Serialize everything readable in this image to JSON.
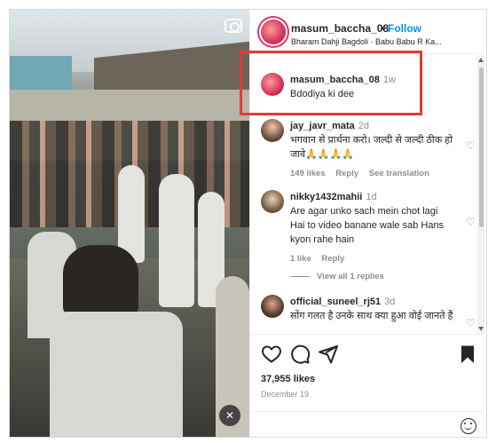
{
  "post": {
    "author": "masum_baccha_08",
    "follow_label": "Follow",
    "dot": "•",
    "audio": "Bharam Dahji Bagdoli · Babu Babu R Ka..."
  },
  "comments": [
    {
      "user": "masum_baccha_08",
      "time": "1w",
      "text": "Bdodiya ki dee"
    },
    {
      "user": "jay_javr_mata",
      "time": "2d",
      "text": "भगवान से प्रार्थना करो। जल्दी से जल्दी ठीक हो जावे🙏🙏🙏🙏",
      "likes": "149 likes",
      "reply": "Reply",
      "translate": "See translation"
    },
    {
      "user": "nikky1432mahii",
      "time": "1d",
      "text": "Are agar unko sach mein chot lagi Hai to video banane wale sab Hans kyon rahe hain",
      "likes": "1 like",
      "reply": "Reply",
      "view_replies": "View all 1 replies"
    },
    {
      "user": "official_suneel_rj51",
      "time": "3d",
      "text": "सोंग गलत है उनके साथ क्या हुआ वोई जानते हैं"
    }
  ],
  "footer": {
    "likes": "37,955 likes",
    "date": "December 19"
  },
  "icons": {
    "like": "heart-icon",
    "comment": "comment-icon",
    "share": "share-icon",
    "save": "bookmark-icon",
    "emoji": "emoji-icon",
    "camera": "camera-icon",
    "mute": "mute-icon"
  },
  "colors": {
    "link": "#0095f6",
    "highlight": "#e53935",
    "muted": "#8e8e8e"
  }
}
